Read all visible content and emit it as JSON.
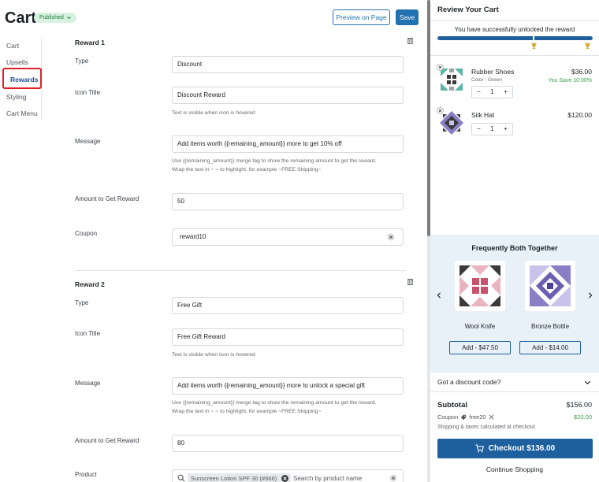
{
  "header": {
    "title": "Cart",
    "status": "Published",
    "preview_label": "Preview on Page",
    "save_label": "Save"
  },
  "nav": {
    "items": [
      "Cart",
      "Upsells",
      "Rewards",
      "Styling",
      "Cart Menu"
    ],
    "active": "Rewards"
  },
  "rewards": [
    {
      "title": "Reward 1",
      "type_label": "Type",
      "type_value": "Discount",
      "icon_title_label": "Icon Title",
      "icon_title_value": "Discount Reward",
      "icon_help": "Text is visible when icon is hovered",
      "message_label": "Message",
      "message_value": "Add items worth {{remaining_amount}} more to get 10% off",
      "message_help_1": "Use {{remaining_amount}} merge tag to show the remaining amount to get the reward.",
      "message_help_2": "Wrap the text in ~ ~ to highlight, for example ~FREE Shipping~",
      "amount_label": "Amount to Get Reward",
      "amount_value": "50",
      "coupon_label": "Coupon",
      "coupon_value": "reward10"
    },
    {
      "title": "Reward 2",
      "type_label": "Type",
      "type_value": "Free Gift",
      "icon_title_label": "Icon Title",
      "icon_title_value": "Free Gift Reward",
      "icon_help": "Text is visible when icon is hovered",
      "message_label": "Message",
      "message_value": "Add items worth {{remaining_amount}} more to unlock a special gift",
      "message_help_1": "Use {{remaining_amount}} merge tag to show the remaining amount to get the reward.",
      "message_help_2": "Wrap the text in ~ ~ to highlight, for example ~FREE Shipping~",
      "amount_label": "Amount to Get Reward",
      "amount_value": "80",
      "product_label": "Product",
      "product_chip": "Sunscreen Lotion SPF 30 (#666)",
      "product_search_placeholder": "Search by product name"
    }
  ],
  "cart": {
    "title": "Review Your Cart",
    "unlock_message": "You have successfully unlocked the reward",
    "progress": 1.0,
    "items": [
      {
        "name": "Rubber Shoes",
        "meta": "Color : Green",
        "price": "$36.00",
        "save": "You Save 10.00%",
        "qty": "1"
      },
      {
        "name": "Silk Hat",
        "meta": "",
        "price": "$120.00",
        "save": "",
        "qty": "1"
      }
    ],
    "fbt": {
      "title": "Frequently Both Together",
      "products": [
        {
          "name": "Wool Knife",
          "add_label": "Add -  $47.50"
        },
        {
          "name": "Bronze Bottle",
          "add_label": "Add -  $14.00"
        }
      ]
    },
    "discount_label": "Got a discount code?",
    "subtotal_label": "Subtotal",
    "subtotal_value": "$156.00",
    "coupon_label": "Coupon",
    "coupon_code": "free20",
    "coupon_value": "$20.00",
    "shipping_note": "Shipping & taxes calculated at checkout",
    "checkout_label": "Checkout  $136.00",
    "continue_label": "Continue Shopping"
  },
  "colors": {
    "accent": "#2271b1",
    "cart_blue": "#1e5f9e",
    "success": "#39a04a",
    "highlight": "#e01f26",
    "fbt_bg": "#e8f1f8"
  }
}
